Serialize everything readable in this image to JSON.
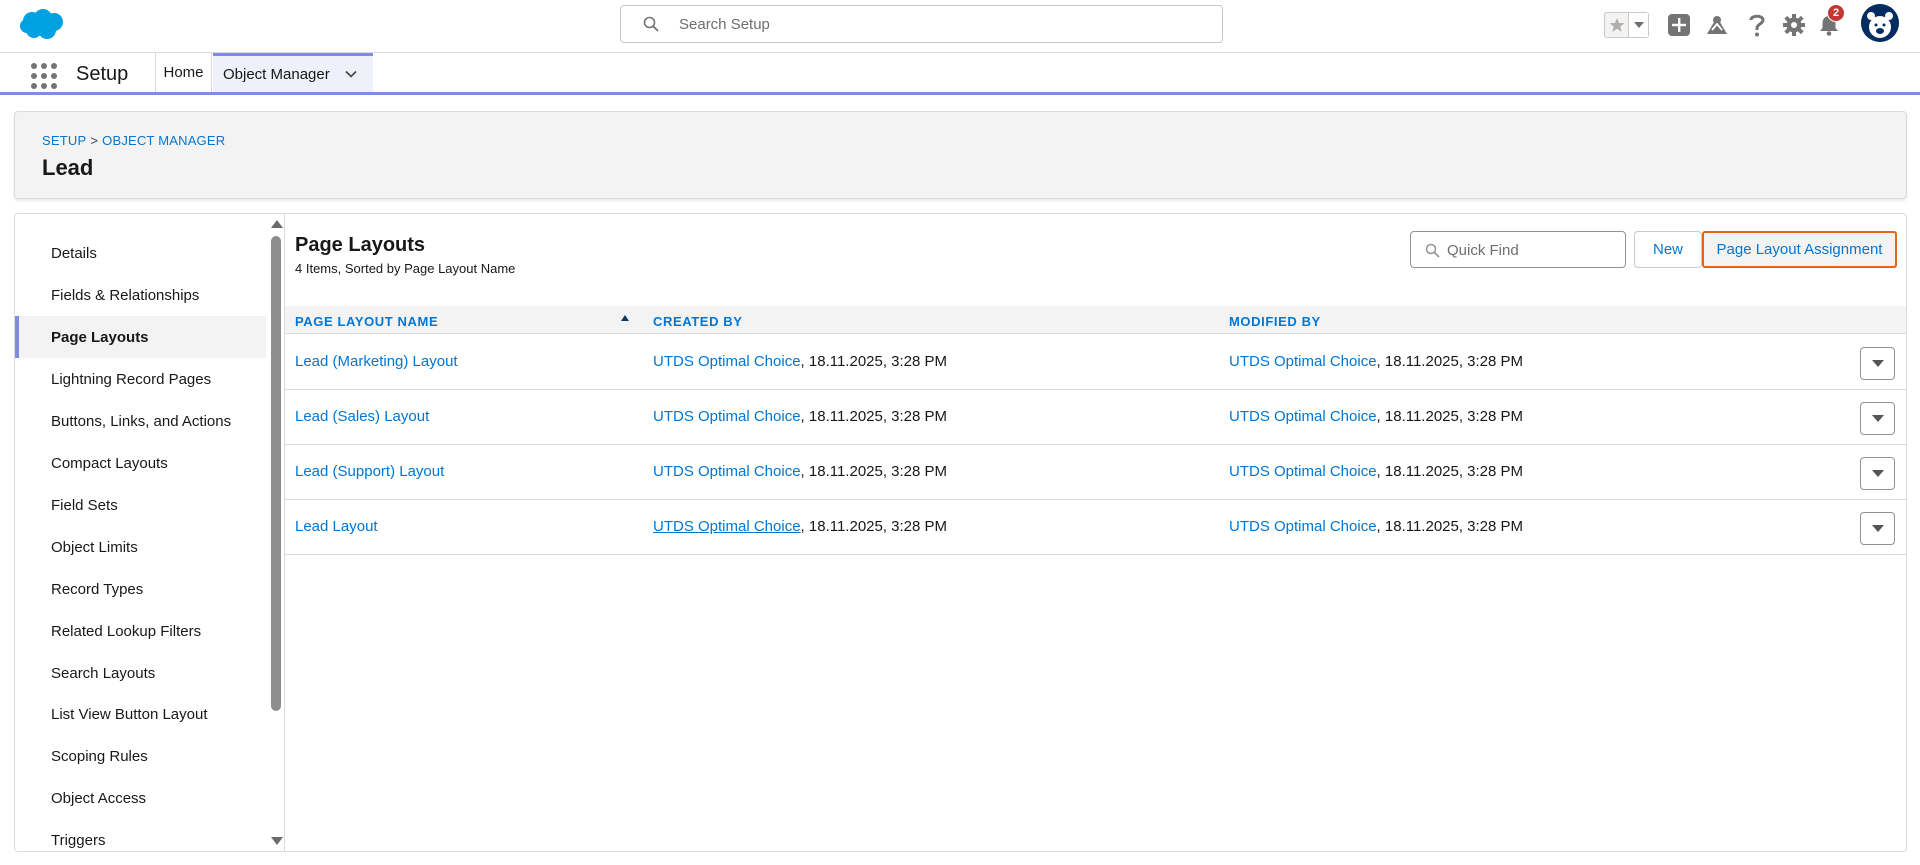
{
  "header": {
    "search_placeholder": "Search Setup",
    "notification_count": "2",
    "icons": [
      "salesforce-cloud-icon",
      "search-icon",
      "favorites-star-icon",
      "favorites-dropdown-icon",
      "global-add-icon",
      "trailhead-icon",
      "help-icon",
      "setup-gear-icon",
      "notification-bell-icon",
      "user-avatar"
    ]
  },
  "context_bar": {
    "app_name": "Setup",
    "tabs": [
      {
        "label": "Home"
      },
      {
        "label": "Object Manager"
      }
    ]
  },
  "page_header": {
    "breadcrumb": [
      "SETUP",
      "OBJECT MANAGER"
    ],
    "breadcrumb_separator": ">",
    "title": "Lead"
  },
  "sidebar": {
    "items": [
      {
        "label": "Details"
      },
      {
        "label": "Fields & Relationships"
      },
      {
        "label": "Page Layouts"
      },
      {
        "label": "Lightning Record Pages"
      },
      {
        "label": "Buttons, Links, and Actions"
      },
      {
        "label": "Compact Layouts"
      },
      {
        "label": "Field Sets"
      },
      {
        "label": "Object Limits"
      },
      {
        "label": "Record Types"
      },
      {
        "label": "Related Lookup Filters"
      },
      {
        "label": "Search Layouts"
      },
      {
        "label": "List View Button Layout"
      },
      {
        "label": "Scoping Rules"
      },
      {
        "label": "Object Access"
      },
      {
        "label": "Triggers"
      }
    ],
    "active_item": "Page Layouts"
  },
  "content": {
    "title": "Page Layouts",
    "subtitle": "4 Items, Sorted by Page Layout Name",
    "quick_find_placeholder": "Quick Find",
    "new_button": "New",
    "assignment_button": "Page Layout Assignment",
    "columns": [
      "PAGE LAYOUT NAME",
      "CREATED BY",
      "MODIFIED BY"
    ],
    "rows": [
      {
        "name": "Lead (Marketing) Layout",
        "created_by": "UTDS Optimal Choice",
        "created_date": ", 18.11.2025, 3:28 PM",
        "modified_by": "UTDS Optimal Choice",
        "modified_date": ", 18.11.2025, 3:28 PM"
      },
      {
        "name": "Lead (Sales) Layout",
        "created_by": "UTDS Optimal Choice",
        "created_date": ", 18.11.2025, 3:28 PM",
        "modified_by": "UTDS Optimal Choice",
        "modified_date": ", 18.11.2025, 3:28 PM"
      },
      {
        "name": "Lead (Support) Layout",
        "created_by": "UTDS Optimal Choice",
        "created_date": ", 18.11.2025, 3:28 PM",
        "modified_by": "UTDS Optimal Choice",
        "modified_date": ", 18.11.2025, 3:28 PM"
      },
      {
        "name": "Lead Layout",
        "created_by": "UTDS Optimal Choice",
        "created_date": ", 18.11.2025, 3:28 PM",
        "modified_by": "UTDS Optimal Choice",
        "modified_date": ", 18.11.2025, 3:28 PM"
      }
    ]
  },
  "colors": {
    "brand_blue": "#0176d3",
    "salesforce_cloud": "#00a1e0",
    "active_accent": "#7f8de1",
    "highlight_border": "#e3641d",
    "badge_red": "#c23934"
  }
}
